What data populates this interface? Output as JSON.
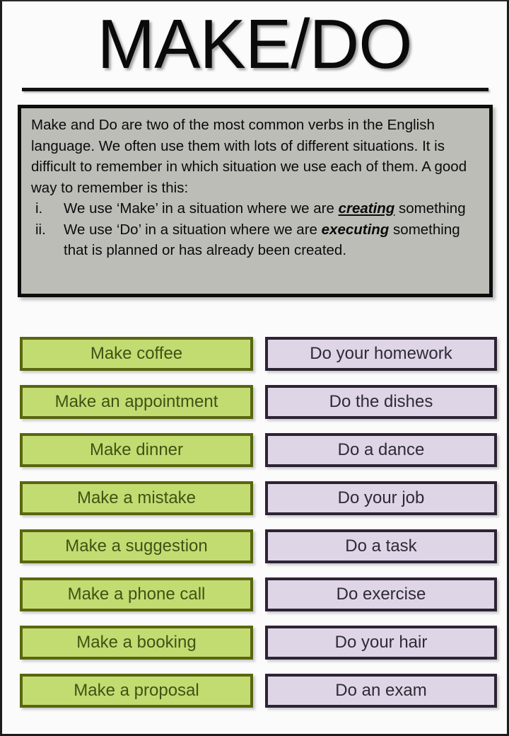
{
  "page": {
    "title": "MAKE/DO"
  },
  "intro": {
    "paragraph": "Make and Do are two of the most common verbs in the English language. We often use them with lots of different situations. It is difficult to remember in which situation we use each of them. A good way to remember is this:",
    "items": [
      {
        "marker": "i.",
        "text_before": "We use ‘Make’ in a situation where we are ",
        "emphasis": "creating",
        "text_after": " something"
      },
      {
        "marker": "ii.",
        "text_before": "We use ‘Do’ in a situation where we are ",
        "emphasis": "executing",
        "text_after": " something that is planned or has already been created."
      }
    ]
  },
  "columns": {
    "make": {
      "accent_fill": "#c2dc72",
      "accent_border": "#596611",
      "accent_text": "#3f5314",
      "items": [
        "Make coffee",
        "Make an appointment",
        "Make dinner",
        "Make a mistake",
        "Make a suggestion",
        "Make a phone call",
        "Make a booking",
        "Make a proposal"
      ]
    },
    "do": {
      "accent_fill": "#ded5e6",
      "accent_border": "#2e2335",
      "accent_text": "#2f2b35",
      "items": [
        "Do your homework",
        "Do the dishes",
        "Do a dance",
        "Do your job",
        "Do a task",
        "Do exercise",
        "Do your hair",
        "Do an exam"
      ]
    }
  }
}
